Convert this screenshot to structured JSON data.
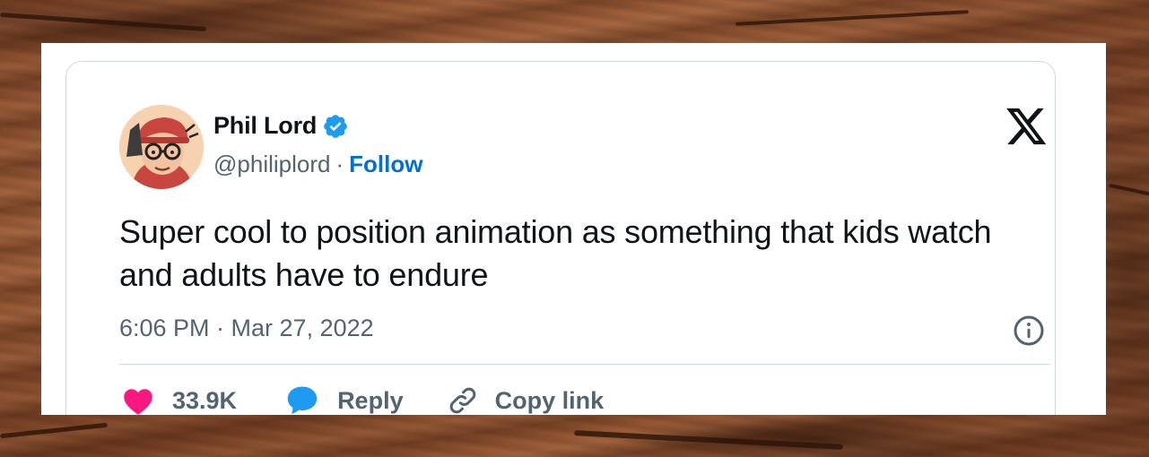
{
  "tweet": {
    "author_name": "Phil Lord",
    "handle": "@philiplord",
    "separator": "·",
    "follow_label": "Follow",
    "text": "Super cool to position animation as something that kids watch and adults have to endure",
    "timestamp": "6:06 PM · Mar 27, 2022",
    "like_count": "33.9K",
    "reply_label": "Reply",
    "copy_link_label": "Copy link"
  },
  "icons": {
    "verified": "verified-badge-icon",
    "platform": "x-logo-icon",
    "info": "info-icon",
    "like": "heart-icon",
    "reply": "speech-bubble-icon",
    "copy": "link-icon"
  },
  "colors": {
    "verified_blue": "#1d9bf0",
    "follow_blue": "#006fd6",
    "heart_pink": "#f91880",
    "reply_blue": "#1d9bf0",
    "text_primary": "#0f1419",
    "text_secondary": "#536471",
    "border": "#cfd9de"
  }
}
